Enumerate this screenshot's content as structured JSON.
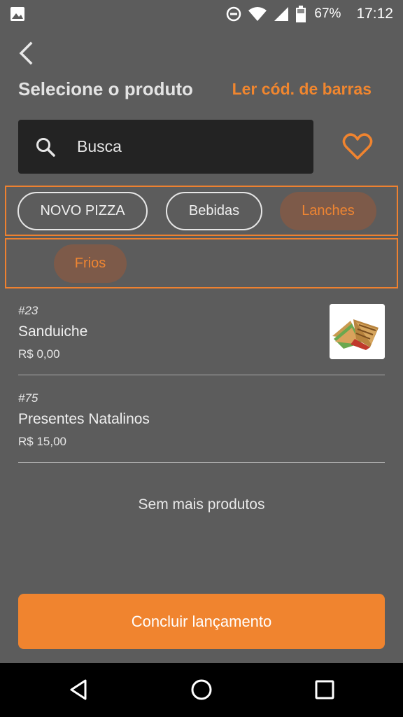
{
  "status_bar": {
    "icons": [
      "image-icon",
      "do-not-disturb-icon",
      "wifi-icon",
      "signal-icon",
      "battery-icon"
    ],
    "battery": "67%",
    "time": "17:12"
  },
  "header": {
    "back_icon": "chevron-left-icon",
    "title": "Selecione o produto",
    "barcode_link": "Ler cód. de barras"
  },
  "search": {
    "icon": "search-icon",
    "placeholder": "Busca",
    "value": ""
  },
  "favorites_icon": "heart-outline-icon",
  "categories": {
    "row1": [
      {
        "label": "NOVO PIZZA",
        "selected": false
      },
      {
        "label": "Bebidas",
        "selected": false
      },
      {
        "label": "Lanches",
        "selected": true
      }
    ],
    "row2": [
      {
        "label": "Frios",
        "selected": true
      }
    ]
  },
  "products": [
    {
      "code": "#23",
      "name": "Sanduiche",
      "price": "R$ 0,00",
      "has_image": true
    },
    {
      "code": "#75",
      "name": "Presentes Natalinos",
      "price": "R$ 15,00",
      "has_image": false
    }
  ],
  "no_more_text": "Sem mais produtos",
  "finish_button": "Concluir lançamento",
  "nav_bar": [
    "back-triangle-icon",
    "home-circle-icon",
    "recents-square-icon"
  ],
  "colors": {
    "accent": "#f0842f",
    "background": "#5c5c5c",
    "search_bg": "#232323",
    "selected_chip_bg": "#7d5a49"
  }
}
